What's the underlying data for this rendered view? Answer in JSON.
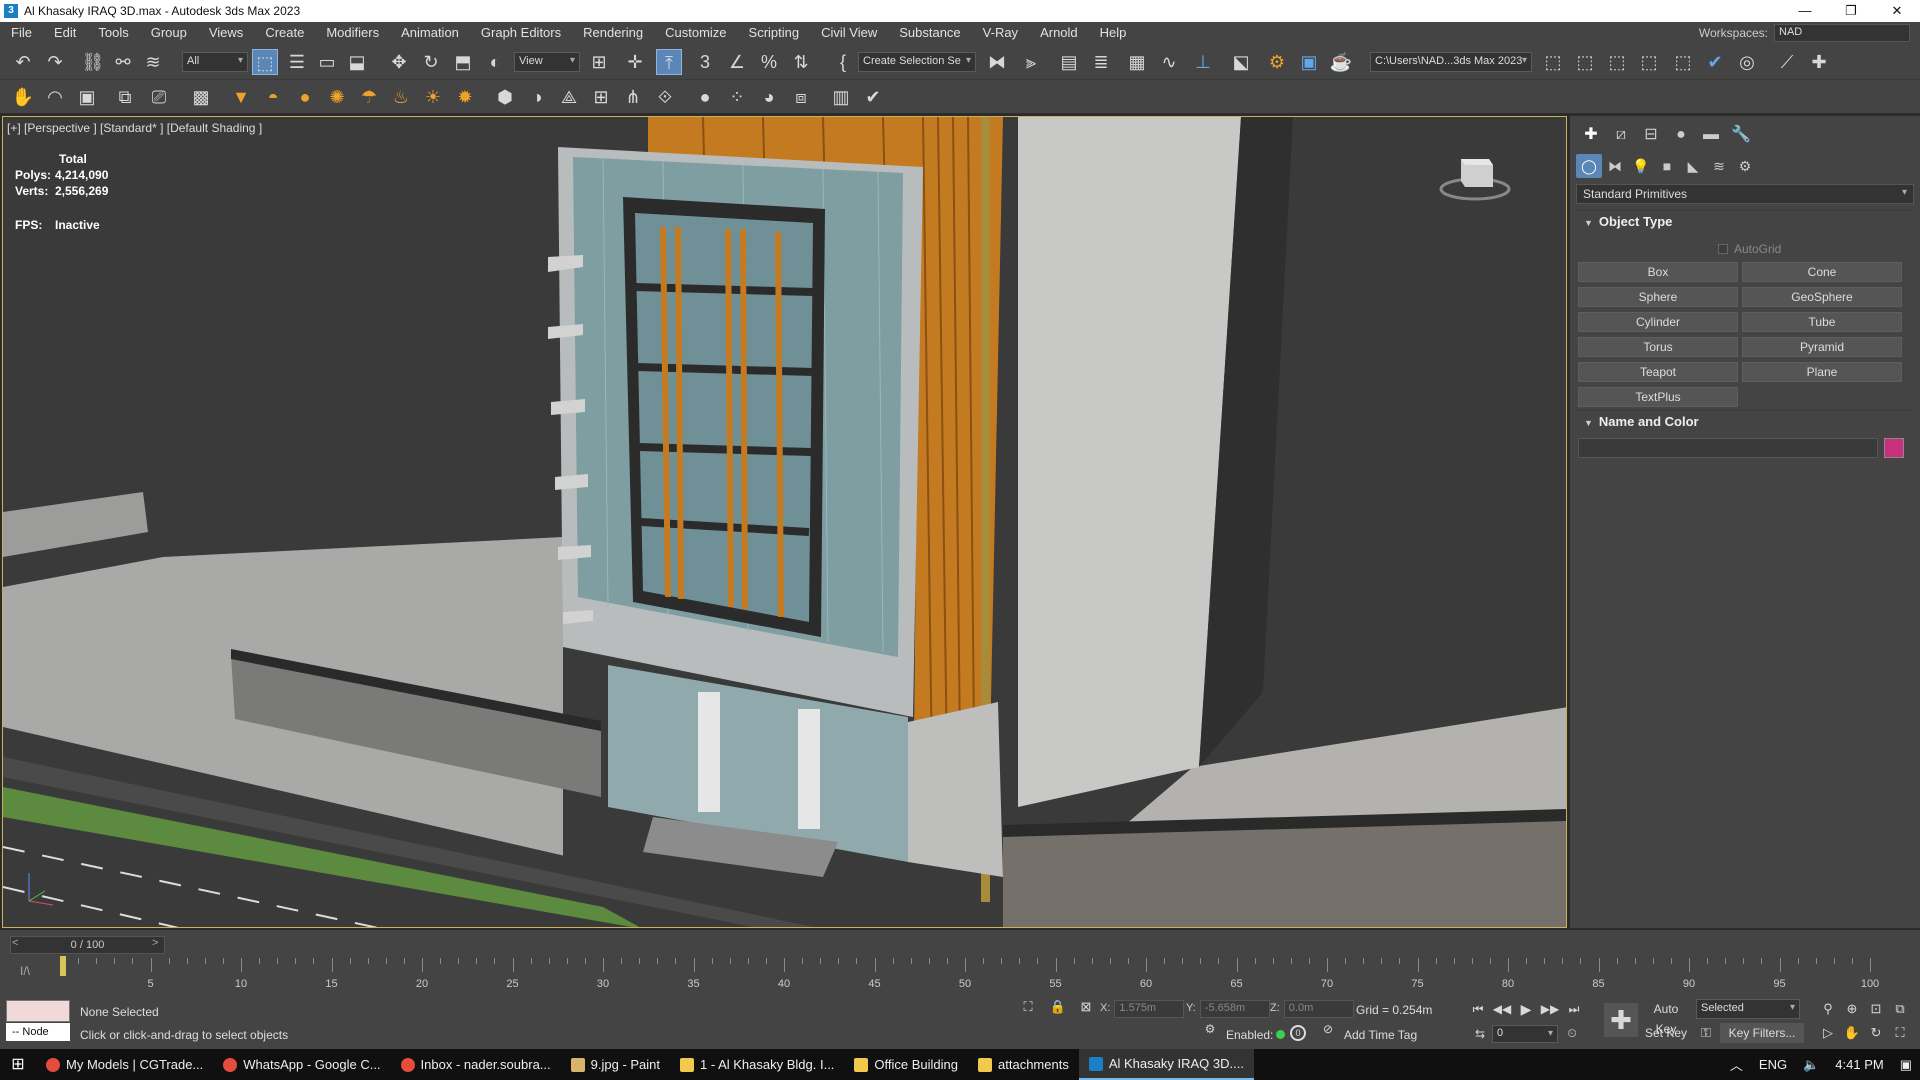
{
  "window": {
    "title": "Al Khasaky IRAQ 3D.max - Autodesk 3ds Max 2023"
  },
  "menu": [
    "File",
    "Edit",
    "Tools",
    "Group",
    "Views",
    "Create",
    "Modifiers",
    "Animation",
    "Graph Editors",
    "Rendering",
    "Customize",
    "Scripting",
    "Civil View",
    "Substance",
    "V-Ray",
    "Arnold",
    "Help"
  ],
  "workspace": {
    "label": "Workspaces:",
    "value": "NAD"
  },
  "toolbar": {
    "filter": "All",
    "ref_coord": "View",
    "selection_set": "Create Selection Se",
    "project_path": "C:\\Users\\NAD...3ds Max 2023"
  },
  "viewport": {
    "label": "[+] [Perspective ] [Standard* ] [Default Shading ]",
    "stats": {
      "total_label": "Total",
      "polys_label": "Polys:",
      "polys": "4,214,090",
      "verts_label": "Verts:",
      "verts": "2,556,269",
      "fps_label": "FPS:",
      "fps": "Inactive"
    }
  },
  "command_panel": {
    "category": "Standard Primitives",
    "object_type_title": "Object Type",
    "autogrid": "AutoGrid",
    "buttons": [
      "Box",
      "Cone",
      "Sphere",
      "GeoSphere",
      "Cylinder",
      "Tube",
      "Torus",
      "Pyramid",
      "Teapot",
      "Plane",
      "TextPlus"
    ],
    "name_color_title": "Name and Color",
    "swatch_color": "#c8317a"
  },
  "timeline": {
    "position": "0 / 100",
    "ticks": [
      "5",
      "10",
      "15",
      "20",
      "25",
      "30",
      "35",
      "40",
      "45",
      "50",
      "55",
      "60",
      "65",
      "70",
      "75",
      "80",
      "85",
      "90",
      "95",
      "100"
    ]
  },
  "status": {
    "node": "-- Node",
    "selection": "None Selected",
    "prompt": "Click or click-and-drag to select objects",
    "x_label": "X:",
    "x": "1.575m",
    "y_label": "Y:",
    "y": "-5.658m",
    "z_label": "Z:",
    "z": "0.0m",
    "grid": "Grid = 0.254m",
    "enabled": "Enabled:",
    "add_time_tag": "Add Time Tag",
    "auto_key": "Auto Key",
    "selected": "Selected",
    "set_key": "Set Key",
    "key_filters": "Key Filters...",
    "frame": "0"
  },
  "taskbar": {
    "items": [
      "My Models | CGTrade...",
      "WhatsApp - Google C...",
      "Inbox - nader.soubra...",
      "9.jpg - Paint",
      "1 - Al Khasaky Bldg. I...",
      "Office Building",
      "attachments",
      "Al Khasaky IRAQ 3D...."
    ],
    "lang": "ENG",
    "time": "4:41 PM"
  }
}
